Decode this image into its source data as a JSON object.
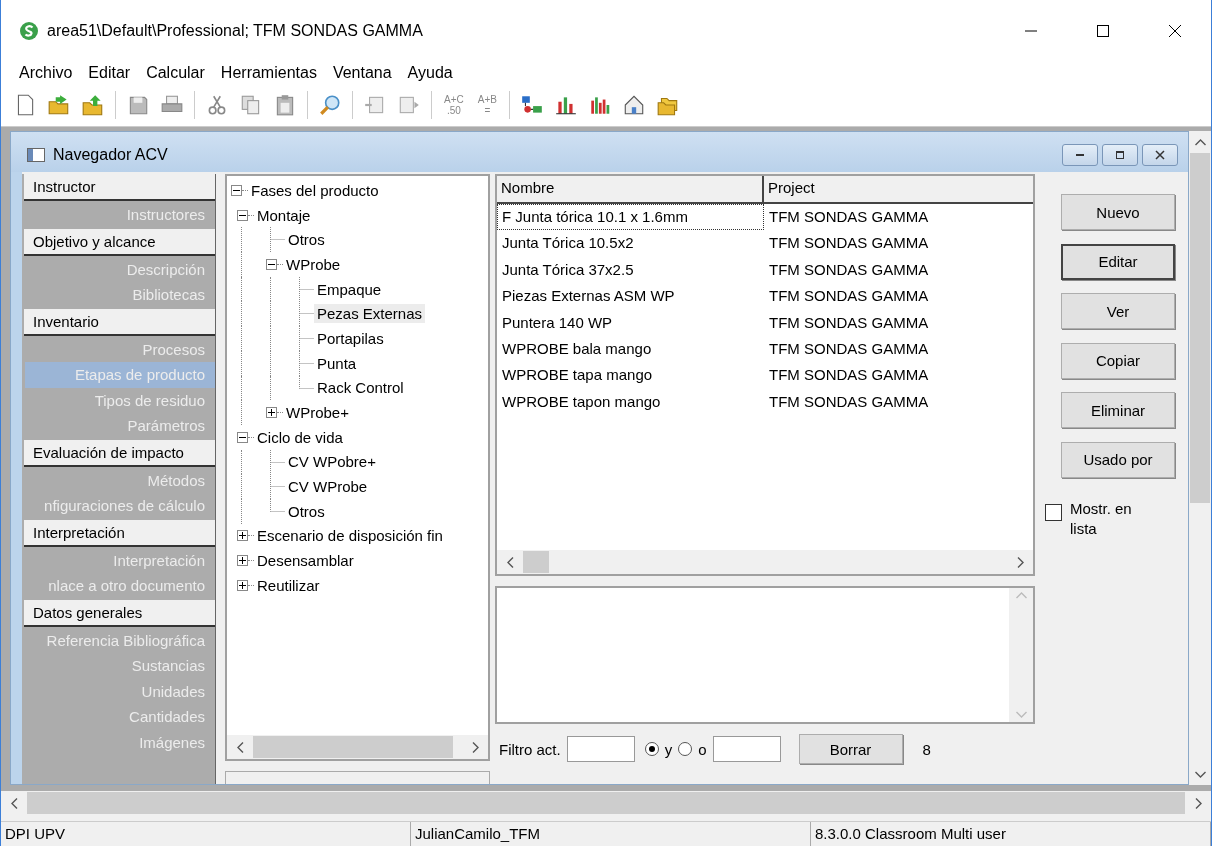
{
  "window": {
    "title": "area51\\Default\\Professional; TFM SONDAS GAMMA"
  },
  "menu": [
    "Archivo",
    "Editar",
    "Calcular",
    "Herramientas",
    "Ventana",
    "Ayuda"
  ],
  "toolbar": {
    "formula_buttons": [
      {
        "top": "A+C",
        "bottom": ".50"
      },
      {
        "top": "A+B",
        "bottom": "="
      }
    ]
  },
  "child_window": {
    "title": "Navegador ACV"
  },
  "sidebar": [
    {
      "header": "Instructor",
      "items": [
        {
          "label": "Instructores",
          "selected": false
        }
      ]
    },
    {
      "header": "Objetivo y alcance",
      "items": [
        {
          "label": "Descripción",
          "selected": false
        },
        {
          "label": "Bibliotecas",
          "selected": false
        }
      ]
    },
    {
      "header": "Inventario",
      "items": [
        {
          "label": "Procesos",
          "selected": false
        },
        {
          "label": "Etapas de producto",
          "selected": true
        },
        {
          "label": "Tipos de residuo",
          "selected": false
        },
        {
          "label": "Parámetros",
          "selected": false
        }
      ]
    },
    {
      "header": "Evaluación de impacto",
      "items": [
        {
          "label": "Métodos",
          "selected": false
        },
        {
          "label": "nfiguraciones de cálculo",
          "selected": false
        }
      ]
    },
    {
      "header": "Interpretación",
      "items": [
        {
          "label": "Interpretación",
          "selected": false
        },
        {
          "label": "nlace a otro documento",
          "selected": false
        }
      ]
    },
    {
      "header": "Datos generales",
      "items": [
        {
          "label": "Referencia Bibliográfica",
          "selected": false
        },
        {
          "label": "Sustancias",
          "selected": false
        },
        {
          "label": "Unidades",
          "selected": false
        },
        {
          "label": "Cantidades",
          "selected": false
        },
        {
          "label": "Imágenes",
          "selected": false
        }
      ]
    }
  ],
  "tree": [
    {
      "label": "Fases del producto",
      "kind": "branch",
      "expanded": true,
      "selected": false,
      "children": [
        {
          "label": "Montaje",
          "kind": "branch",
          "expanded": true,
          "selected": false,
          "children": [
            {
              "label": "Otros",
              "kind": "leaf",
              "selected": false
            },
            {
              "label": "WProbe",
              "kind": "branch",
              "expanded": true,
              "selected": false,
              "children": [
                {
                  "label": "Empaque",
                  "kind": "leaf",
                  "selected": false
                },
                {
                  "label": "Pezas Externas",
                  "kind": "leaf",
                  "selected": true
                },
                {
                  "label": "Portapilas",
                  "kind": "leaf",
                  "selected": false
                },
                {
                  "label": "Punta",
                  "kind": "leaf",
                  "selected": false
                },
                {
                  "label": "Rack Control",
                  "kind": "leaf",
                  "selected": false
                }
              ]
            },
            {
              "label": "WProbe+",
              "kind": "branch",
              "expanded": false,
              "selected": false
            }
          ]
        },
        {
          "label": "Ciclo de vida",
          "kind": "branch",
          "expanded": true,
          "selected": false,
          "children": [
            {
              "label": "CV WPobre+",
              "kind": "leaf",
              "selected": false
            },
            {
              "label": "CV WProbe",
              "kind": "leaf",
              "selected": false
            },
            {
              "label": "Otros",
              "kind": "leaf",
              "selected": false
            }
          ]
        },
        {
          "label": "Escenario de disposición fin",
          "kind": "branch",
          "expanded": false,
          "selected": false
        },
        {
          "label": "Desensamblar",
          "kind": "branch",
          "expanded": false,
          "selected": false
        },
        {
          "label": "Reutilizar",
          "kind": "branch",
          "expanded": false,
          "selected": false
        }
      ]
    }
  ],
  "table": {
    "columns": [
      "Nombre",
      "Project"
    ],
    "rows": [
      {
        "cells": [
          "F Junta tórica  10.1 x 1.6mm",
          "TFM SONDAS GAMMA"
        ],
        "focused": true
      },
      {
        "cells": [
          "Junta Tórica  10.5x2",
          "TFM SONDAS GAMMA"
        ],
        "focused": false
      },
      {
        "cells": [
          "Junta Tórica  37x2.5",
          "TFM SONDAS GAMMA"
        ],
        "focused": false
      },
      {
        "cells": [
          "Piezas Externas ASM WP",
          "TFM SONDAS GAMMA"
        ],
        "focused": false
      },
      {
        "cells": [
          "Puntera 140 WP",
          "TFM SONDAS GAMMA"
        ],
        "focused": false
      },
      {
        "cells": [
          "WPROBE bala mango",
          "TFM SONDAS GAMMA"
        ],
        "focused": false
      },
      {
        "cells": [
          "WPROBE tapa mango",
          "TFM SONDAS GAMMA"
        ],
        "focused": false
      },
      {
        "cells": [
          "WPROBE tapon mango",
          "TFM SONDAS GAMMA"
        ],
        "focused": false
      }
    ]
  },
  "buttons": [
    {
      "label": "Nuevo",
      "default": false
    },
    {
      "label": "Editar",
      "default": true
    },
    {
      "label": "Ver",
      "default": false
    },
    {
      "label": "Copiar",
      "default": false
    },
    {
      "label": "Eliminar",
      "default": false
    },
    {
      "label": "Usado por",
      "default": false
    }
  ],
  "show_in_list": {
    "label": "Mostr. en lista",
    "checked": false
  },
  "filter": {
    "label": "Filtro act.",
    "options": [
      {
        "label": "y",
        "selected": true
      },
      {
        "label": "o",
        "selected": false
      }
    ],
    "clear_button": "Borrar",
    "count": "8"
  },
  "status_bar": [
    "DPI UPV",
    "JulianCamilo_TFM",
    "8.3.0.0 Classroom Multi user"
  ]
}
